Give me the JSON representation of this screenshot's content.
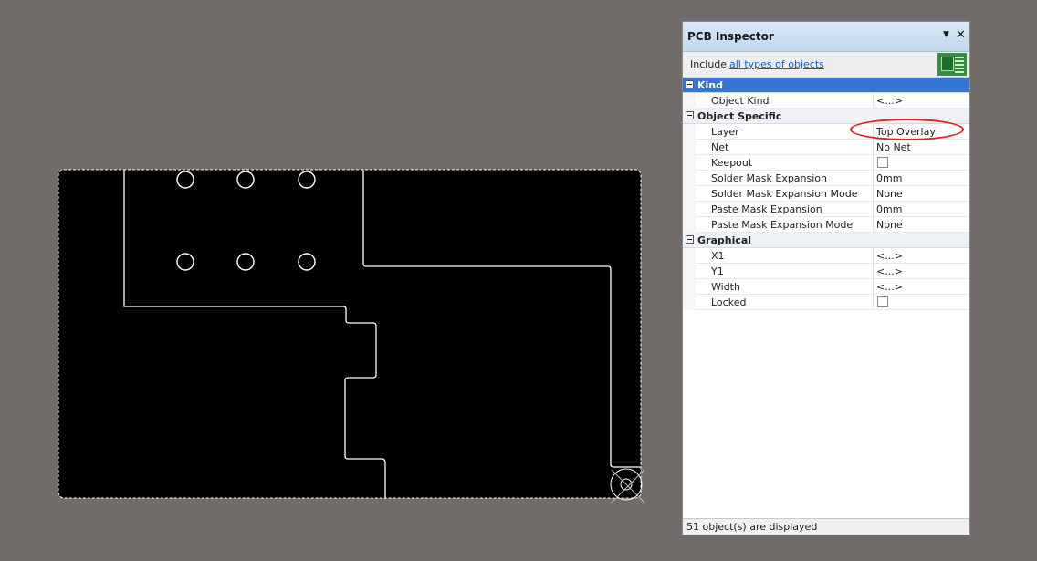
{
  "panel": {
    "title": "PCB Inspector",
    "include_label": "Include",
    "filter_link": "all types of objects"
  },
  "sections": [
    {
      "label": "Kind",
      "selected": true,
      "rows": [
        {
          "name": "Object Kind",
          "value": "<...>"
        }
      ]
    },
    {
      "label": "Object Specific",
      "selected": false,
      "rows": [
        {
          "name": "Layer",
          "value": "Top Overlay"
        },
        {
          "name": "Net",
          "value": "No Net"
        },
        {
          "name": "Keepout",
          "checkbox": true,
          "checked": false
        },
        {
          "name": "Solder Mask Expansion",
          "value": "0mm"
        },
        {
          "name": "Solder Mask Expansion Mode",
          "value": "None"
        },
        {
          "name": "Paste Mask Expansion",
          "value": "0mm"
        },
        {
          "name": "Paste Mask Expansion Mode",
          "value": "None"
        }
      ]
    },
    {
      "label": "Graphical",
      "selected": false,
      "rows": [
        {
          "name": "X1",
          "value": "<...>"
        },
        {
          "name": "Y1",
          "value": "<...>"
        },
        {
          "name": "Width",
          "value": "<...>"
        },
        {
          "name": "Locked",
          "checkbox": true,
          "checked": false
        }
      ]
    }
  ],
  "status": {
    "text": "51 object(s) are displayed"
  },
  "icons": {
    "dropdown": "dropdown-arrow-icon",
    "close": "close-icon",
    "filter": "pcb-filter-icon",
    "origin": "origin-marker-icon"
  },
  "colors": {
    "workspace": "#716c6a",
    "board": "#000000",
    "outline": "#ffffff",
    "selected_header": "#3575d3",
    "annotation": "#e02020",
    "link": "#1060c0"
  }
}
